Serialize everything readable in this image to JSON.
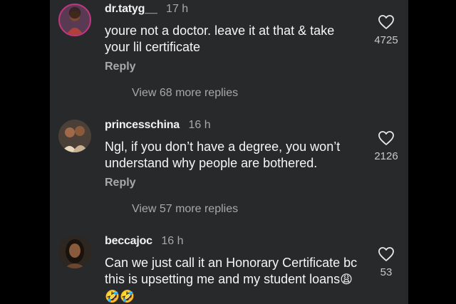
{
  "comments": [
    {
      "username": "dr.tatyg__",
      "time": "17 h",
      "text": "youre not a doctor. leave it at that & take your lil certificate",
      "reply": "Reply",
      "view_replies": "View 68 more replies",
      "likes": "4725",
      "avatar_icon": "profile-photo-icon"
    },
    {
      "username": "princesschina",
      "time": "16 h",
      "text": "Ngl, if you don’t have a degree, you won’t understand why people are bothered.",
      "reply": "Reply",
      "view_replies": "View 57 more replies",
      "likes": "2126",
      "avatar_icon": "profile-photo-icon"
    },
    {
      "username": "beccajoc",
      "time": "16 h",
      "text": "Can we just call it an Honorary Certificate bc this is upsetting me and my student loans",
      "emojis": "😩🤣🤣",
      "likes": "53",
      "avatar_icon": "profile-photo-icon"
    }
  ],
  "colors": {
    "background": "#27292b",
    "text": "#f5f5f5",
    "muted": "#a8a8a8",
    "story_ring": "#c13584"
  }
}
